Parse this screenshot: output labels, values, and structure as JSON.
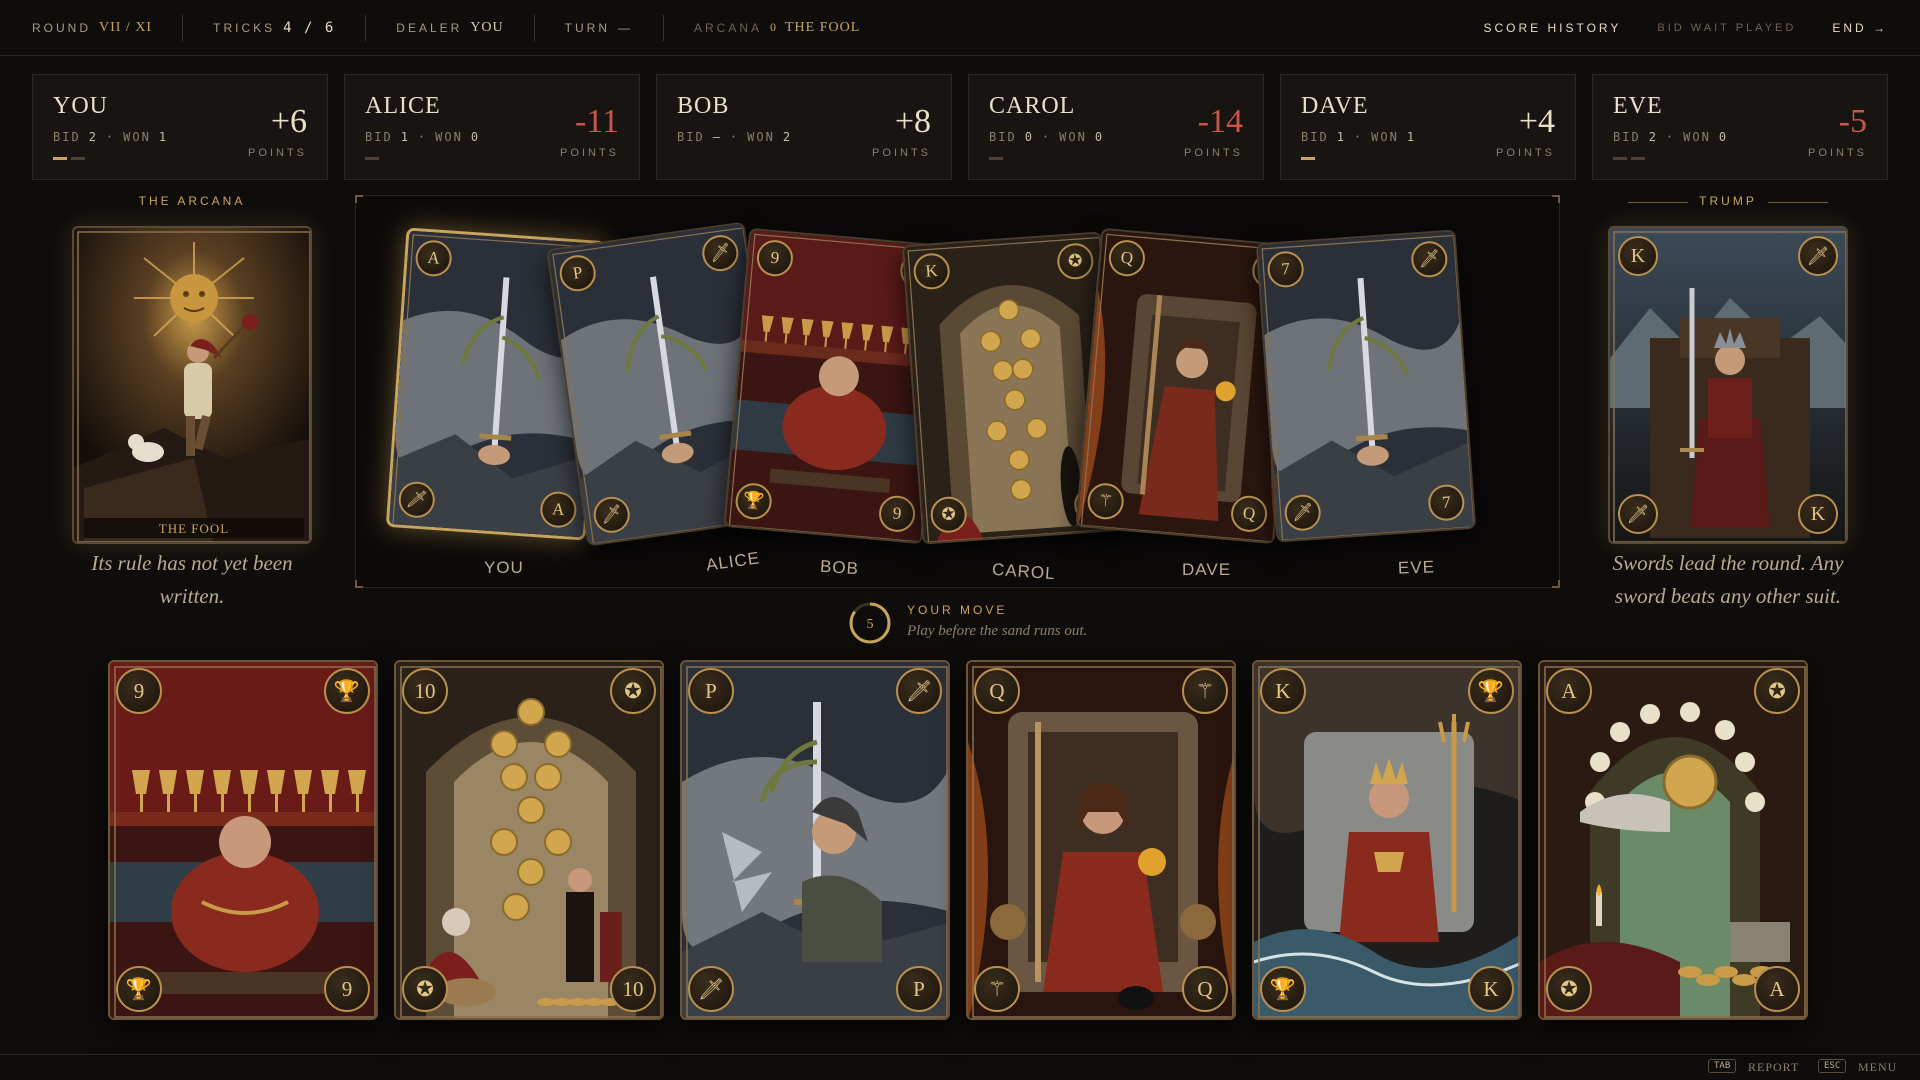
{
  "topbar": {
    "round_label": "ROUND",
    "round_value": "VII / XI",
    "tricks_label": "TRICKS",
    "tricks_value": "4 / 6",
    "dealer_label": "DEALER",
    "dealer_value": "YOU",
    "turn_label": "TURN",
    "turn_value": "—",
    "arcana_label": "ARCANA",
    "arcana_num": "0",
    "arcana_name": "THE FOOL",
    "score_history": "SCORE HISTORY",
    "status": "BID WAIT PLAYED",
    "end": "END →"
  },
  "players": [
    {
      "name": "YOU",
      "bid": "2",
      "won": "1",
      "score": "+6",
      "bars": [
        true,
        false
      ]
    },
    {
      "name": "ALICE",
      "bid": "1",
      "won": "0",
      "score": "-11",
      "bars": [
        false
      ]
    },
    {
      "name": "BOB",
      "bid": "—",
      "won": "2",
      "score": "+8",
      "bars": []
    },
    {
      "name": "CAROL",
      "bid": "0",
      "won": "0",
      "score": "-14",
      "bars": [
        false
      ]
    },
    {
      "name": "DAVE",
      "bid": "1",
      "won": "1",
      "score": "+4",
      "bars": [
        true
      ]
    },
    {
      "name": "EVE",
      "bid": "2",
      "won": "0",
      "score": "-5",
      "bars": [
        false,
        false
      ]
    }
  ],
  "labels": {
    "bid": "BID",
    "won": "WON",
    "points": "POINTS",
    "sep": "·"
  },
  "arcana": {
    "title": "THE ARCANA",
    "card_name": "THE FOOL",
    "caption": "Its rule has not yet been written."
  },
  "trump": {
    "title": "TRUMP",
    "rank": "K",
    "caption": "Swords lead the round. Any sword beats any other suit."
  },
  "trick": {
    "cards": [
      {
        "player": "YOU",
        "rank": "A",
        "suit": "sword",
        "winning": true
      },
      {
        "player": "ALICE",
        "rank": "P",
        "suit": "sword",
        "winning": false
      },
      {
        "player": "BOB",
        "rank": "9",
        "suit": "cup",
        "winning": false
      },
      {
        "player": "CAROL",
        "rank": "K",
        "suit": "coin",
        "winning": false
      },
      {
        "player": "DAVE",
        "rank": "Q",
        "suit": "wand",
        "winning": false
      },
      {
        "player": "EVE",
        "rank": "7",
        "suit": "sword",
        "winning": false
      }
    ]
  },
  "move": {
    "timer": "5",
    "timer_fraction": 0.85,
    "title": "YOUR MOVE",
    "subtitle": "Play before the sand runs out."
  },
  "hand": [
    {
      "rank": "9",
      "suit": "cup",
      "scene": "nine-of-cups"
    },
    {
      "rank": "10",
      "suit": "coin",
      "scene": "ten-of-coins"
    },
    {
      "rank": "P",
      "suit": "sword",
      "scene": "page-of-swords"
    },
    {
      "rank": "Q",
      "suit": "wand",
      "scene": "queen-of-wands"
    },
    {
      "rank": "K",
      "suit": "cup",
      "scene": "king-of-cups"
    },
    {
      "rank": "A",
      "suit": "coin",
      "scene": "ace-of-coins"
    }
  ],
  "footer": {
    "tab_key": "TAB",
    "tab_label": "REPORT",
    "esc_key": "ESC",
    "esc_label": "MENU"
  },
  "colors": {
    "gold": "#c9a45c",
    "negative": "#c8564a",
    "background": "#0f0d0b"
  }
}
